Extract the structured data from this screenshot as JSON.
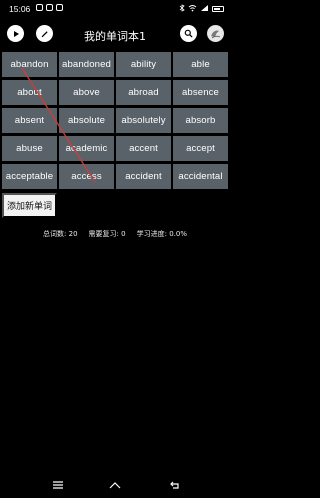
{
  "status": {
    "time": "15:06",
    "icons": [
      "notification-icon",
      "notification-icon",
      "notification-icon",
      "bluetooth-icon",
      "wifi-icon",
      "signal-icon",
      "battery-icon"
    ]
  },
  "header": {
    "title": "我的单词本1",
    "left_buttons": [
      "play-icon",
      "edit-icon"
    ],
    "right_buttons": [
      "search-icon",
      "profile-icon"
    ]
  },
  "words": [
    "abandon",
    "abandoned",
    "ability",
    "able",
    "about",
    "above",
    "abroad",
    "absence",
    "absent",
    "absolute",
    "absolutely",
    "absorb",
    "abuse",
    "academic",
    "accent",
    "accept",
    "acceptable",
    "access",
    "accident",
    "accidental"
  ],
  "actions": {
    "add_word_label": "添加新单词"
  },
  "stats": {
    "total_label": "总词数:",
    "total_value": "20",
    "review_label": "需要复习:",
    "review_value": "0",
    "progress_label": "学习进度:",
    "progress_value": "0.0%"
  },
  "theme": {
    "background": "#000000",
    "tile": "#596269",
    "pointer": "#d03b3b"
  }
}
